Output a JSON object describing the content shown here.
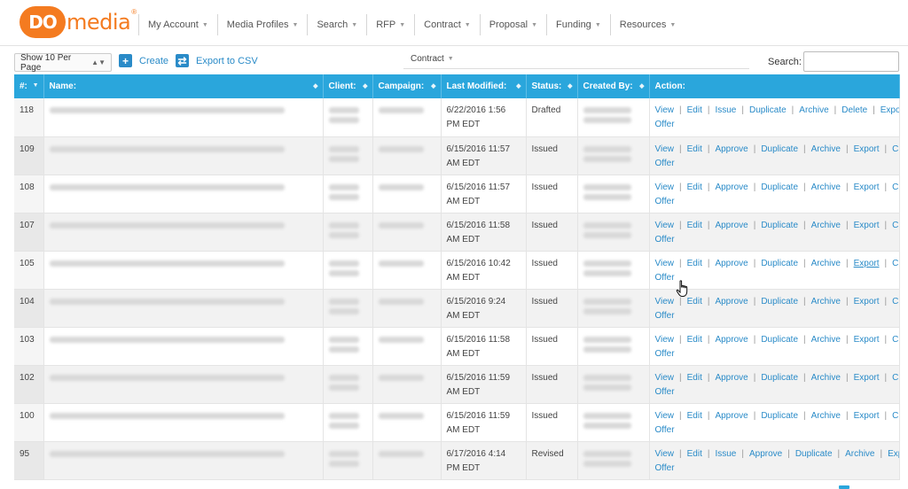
{
  "brand": {
    "do": "DO",
    "media": "media",
    "reg": "®"
  },
  "nav": [
    "My Account",
    "Media Profiles",
    "Search",
    "RFP",
    "Contract",
    "Proposal",
    "Funding",
    "Resources"
  ],
  "toolbar": {
    "per_page": "Show 10 Per Page",
    "create_label": "Create",
    "export_csv_label": "Export to CSV",
    "contract_menu": "Contract",
    "search_label": "Search:",
    "search_value": ""
  },
  "table": {
    "headers": [
      "#:",
      "Name:",
      "Client:",
      "Campaign:",
      "Last Modified:",
      "Status:",
      "Created By:",
      "Action:"
    ],
    "rows": [
      {
        "id": "118",
        "modified": "6/22/2016 1:56 PM EDT",
        "status": "Drafted",
        "actions": [
          "View",
          "Edit",
          "Issue",
          "Duplicate",
          "Archive",
          "Delete",
          "Export",
          "Create Offer"
        ]
      },
      {
        "id": "109",
        "modified": "6/15/2016 11:57 AM EDT",
        "status": "Issued",
        "actions": [
          "View",
          "Edit",
          "Approve",
          "Duplicate",
          "Archive",
          "Export",
          "Create Offer"
        ]
      },
      {
        "id": "108",
        "modified": "6/15/2016 11:57 AM EDT",
        "status": "Issued",
        "actions": [
          "View",
          "Edit",
          "Approve",
          "Duplicate",
          "Archive",
          "Export",
          "Create Offer"
        ]
      },
      {
        "id": "107",
        "modified": "6/15/2016 11:58 AM EDT",
        "status": "Issued",
        "actions": [
          "View",
          "Edit",
          "Approve",
          "Duplicate",
          "Archive",
          "Export",
          "Create Offer"
        ]
      },
      {
        "id": "105",
        "modified": "6/15/2016 10:42 AM EDT",
        "status": "Issued",
        "actions": [
          "View",
          "Edit",
          "Approve",
          "Duplicate",
          "Archive",
          "Export",
          "Create Offer"
        ]
      },
      {
        "id": "104",
        "modified": "6/15/2016 9:24 AM EDT",
        "status": "Issued",
        "actions": [
          "View",
          "Edit",
          "Approve",
          "Duplicate",
          "Archive",
          "Export",
          "Create Offer"
        ]
      },
      {
        "id": "103",
        "modified": "6/15/2016 11:58 AM EDT",
        "status": "Issued",
        "actions": [
          "View",
          "Edit",
          "Approve",
          "Duplicate",
          "Archive",
          "Export",
          "Create Offer"
        ]
      },
      {
        "id": "102",
        "modified": "6/15/2016 11:59 AM EDT",
        "status": "Issued",
        "actions": [
          "View",
          "Edit",
          "Approve",
          "Duplicate",
          "Archive",
          "Export",
          "Create Offer"
        ]
      },
      {
        "id": "100",
        "modified": "6/15/2016 11:59 AM EDT",
        "status": "Issued",
        "actions": [
          "View",
          "Edit",
          "Approve",
          "Duplicate",
          "Archive",
          "Export",
          "Create Offer"
        ]
      },
      {
        "id": "95",
        "modified": "6/17/2016 4:14 PM EDT",
        "status": "Revised",
        "actions": [
          "View",
          "Edit",
          "Issue",
          "Approve",
          "Duplicate",
          "Archive",
          "Export",
          "Create Offer"
        ]
      }
    ]
  },
  "colors": {
    "brand_orange": "#f47b20",
    "header_blue": "#2aa6dc",
    "link_blue": "#2a8bc8"
  },
  "icons": {
    "create": "plus-icon",
    "export": "export-icon",
    "cursor": "hand-pointer-icon"
  }
}
